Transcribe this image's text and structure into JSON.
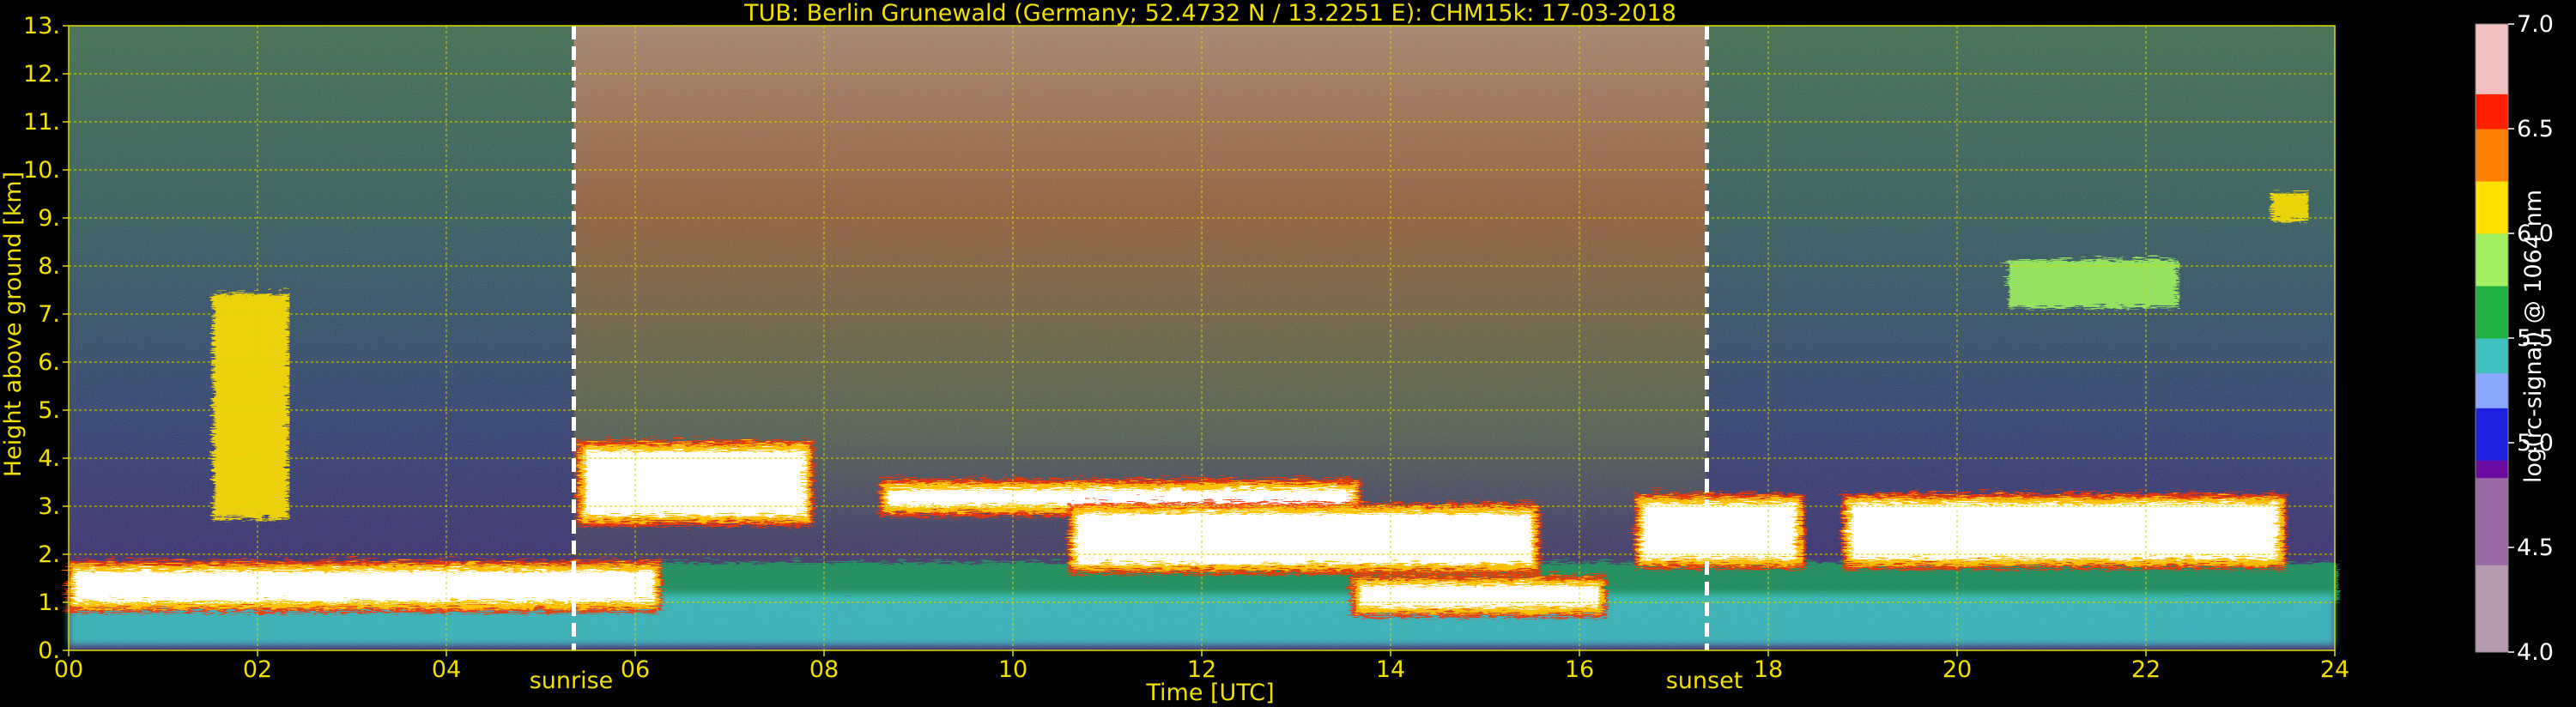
{
  "chart_data": {
    "type": "heatmap",
    "title": "TUB: Berlin Grunewald (Germany; 52.4732 N / 13.2251 E):    CHM15k: 17-03-2018",
    "xlabel": "Time [UTC]",
    "ylabel": "Height above ground [km]",
    "xlim": [
      0,
      24
    ],
    "ylim": [
      0,
      13
    ],
    "x_ticks": [
      "00",
      "02",
      "04",
      "06",
      "08",
      "10",
      "12",
      "14",
      "16",
      "18",
      "20",
      "22",
      "24"
    ],
    "y_ticks": [
      "0.",
      "1.",
      "2.",
      "3.",
      "4.",
      "5.",
      "6.",
      "7.",
      "8.",
      "9.",
      "10.",
      "11.",
      "12.",
      "13."
    ],
    "grid": true,
    "colorbar": {
      "label": "log(rc-signal) @ 1064 nm",
      "range": [
        4.0,
        7.0
      ],
      "ticks": [
        "4.0",
        "4.5",
        "5.0",
        "5.5",
        "6.0",
        "6.5",
        "7.0"
      ]
    },
    "annotations": [
      {
        "label": "sunrise",
        "time_h": 5.35
      },
      {
        "label": "sunset",
        "time_h": 17.35
      }
    ],
    "features": [
      {
        "name": "boundary layer aerosol",
        "t_start": 0,
        "t_end": 24,
        "h_bottom": 0.1,
        "h_top": 1.9,
        "level": 5.4
      },
      {
        "name": "low cloud deck",
        "t_start": 0,
        "t_end": 6.2,
        "h_bottom": 1.0,
        "h_top": 1.8,
        "level": 7.0
      },
      {
        "name": "cloud layer",
        "t_start": 5.4,
        "t_end": 7.8,
        "h_bottom": 2.8,
        "h_top": 4.3,
        "level": 7.0
      },
      {
        "name": "cloud layer",
        "t_start": 8.6,
        "t_end": 13.6,
        "h_bottom": 3.0,
        "h_top": 3.5,
        "level": 7.0
      },
      {
        "name": "cloud layer",
        "t_start": 10.6,
        "t_end": 15.5,
        "h_bottom": 1.8,
        "h_top": 3.0,
        "level": 7.0
      },
      {
        "name": "cloud layer",
        "t_start": 13.6,
        "t_end": 16.2,
        "h_bottom": 0.9,
        "h_top": 1.5,
        "level": 7.0
      },
      {
        "name": "cloud layer",
        "t_start": 16.6,
        "t_end": 18.3,
        "h_bottom": 1.9,
        "h_top": 3.2,
        "level": 7.0
      },
      {
        "name": "cloud layer",
        "t_start": 18.8,
        "t_end": 23.4,
        "h_bottom": 1.9,
        "h_top": 3.2,
        "level": 7.0
      },
      {
        "name": "elevated aerosol plume",
        "t_start": 1.5,
        "t_end": 2.3,
        "h_bottom": 2.8,
        "h_top": 7.5,
        "level": 6.2
      },
      {
        "name": "cirrus",
        "t_start": 20.5,
        "t_end": 22.3,
        "h_bottom": 7.2,
        "h_top": 8.2,
        "level": 5.8
      },
      {
        "name": "cirrus",
        "t_start": 23.3,
        "t_end": 23.7,
        "h_bottom": 9.0,
        "h_top": 9.6,
        "level": 6.2
      }
    ]
  }
}
